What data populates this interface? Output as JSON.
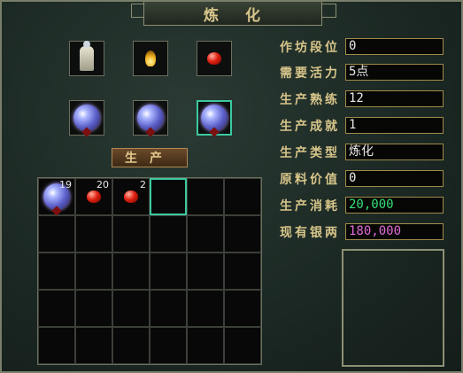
{
  "window": {
    "title_left": "炼",
    "title_right": "化"
  },
  "recipe_slots": [
    {
      "icon": "white-robed-figure-icon",
      "selected": false
    },
    {
      "icon": "golden-flame-icon",
      "selected": false
    },
    {
      "icon": "red-gem-icon",
      "selected": false
    },
    {
      "icon": "purple-orb-icon",
      "selected": false
    },
    {
      "icon": "purple-orb-icon",
      "selected": false
    },
    {
      "icon": "purple-orb-icon",
      "selected": true
    }
  ],
  "produce_button": "生产",
  "stats": [
    {
      "label": "作坊段位",
      "value": "0",
      "color": "#e8e8e8"
    },
    {
      "label": "需要活力",
      "value": "5点",
      "color": "#e8e8e8"
    },
    {
      "label": "生产熟练",
      "value": "12",
      "color": "#e8e8e8"
    },
    {
      "label": "生产成就",
      "value": "1",
      "color": "#e8e8e8"
    },
    {
      "label": "生产类型",
      "value": "炼化",
      "color": "#e8e8e8"
    },
    {
      "label": "原料价值",
      "value": "0",
      "color": "#e8e8e8"
    },
    {
      "label": "生产消耗",
      "value": "20,000",
      "color": "#33e07a"
    },
    {
      "label": "现有银两",
      "value": "180,000",
      "color": "#e06ad8"
    }
  ],
  "inventory": [
    {
      "icon": "purple-orb-icon",
      "count": "19"
    },
    {
      "icon": "red-gem-icon",
      "count": "20"
    },
    {
      "icon": "red-gem-icon",
      "count": "2"
    }
  ],
  "colors": {
    "accent_selected": "#3cc8a0",
    "label_gold": "#d7c58a"
  }
}
